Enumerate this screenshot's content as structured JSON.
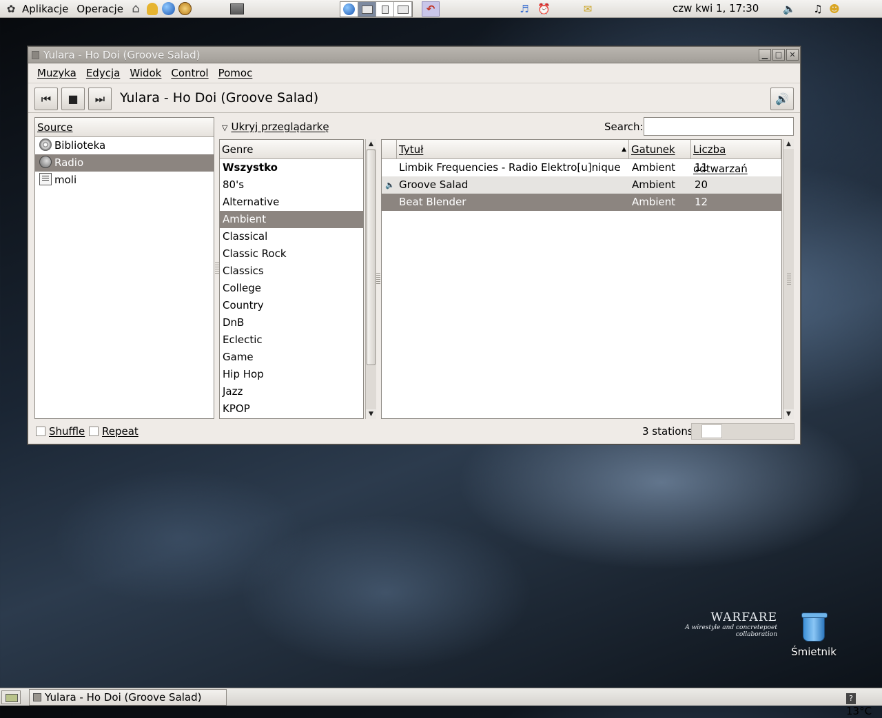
{
  "top_panel": {
    "menus": [
      "Aplikacje",
      "Operacje"
    ],
    "clock": "czw kwi  1, 17:30"
  },
  "window": {
    "title": "Yulara - Ho Doi (Groove Salad)",
    "menu": [
      "Muzyka",
      "Edycja",
      "Widok",
      "Control",
      "Pomoc"
    ],
    "now_playing": "Yulara - Ho Doi (Groove Salad)",
    "source": {
      "header": "Source",
      "items": [
        "Biblioteka",
        "Radio",
        "moli"
      ],
      "selected": 1
    },
    "browser_toggle": "Ukryj przeglądarkę",
    "search_label": "Search:",
    "search_value": "",
    "genres": {
      "header": "Genre",
      "items": [
        "Wszystko",
        "80's",
        "Alternative",
        "Ambient",
        "Classical",
        "Classic Rock",
        "Classics",
        "College",
        "Country",
        "DnB",
        "Eclectic",
        "Game",
        "Hip Hop",
        "Jazz",
        "KPOP"
      ],
      "selected": 3
    },
    "stations": {
      "columns": [
        "Tytuł",
        "Gatunek",
        "Liczba odtwarzań"
      ],
      "rows": [
        {
          "title": "Limbik Frequencies - Radio Elektro[u]nique",
          "genre": "Ambient",
          "plays": "11"
        },
        {
          "title": "Groove Salad",
          "genre": "Ambient",
          "plays": "20"
        },
        {
          "title": "Beat Blender",
          "genre": "Ambient",
          "plays": "12"
        }
      ],
      "playing_row": 1,
      "selected_row": 2
    },
    "status": {
      "shuffle_label": "Shuffle",
      "repeat_label": "Repeat",
      "count_text": "3 stations"
    }
  },
  "desktop": {
    "watermark_title": "WARFARE",
    "watermark_subtitle": "A wirestyle and concretepoet collaboration",
    "trash_label": "Śmietnik"
  },
  "bottom_panel": {
    "task_label": "Yulara - Ho Doi (Groove Salad)",
    "weather_icon": "?",
    "temperature": "13°C"
  }
}
